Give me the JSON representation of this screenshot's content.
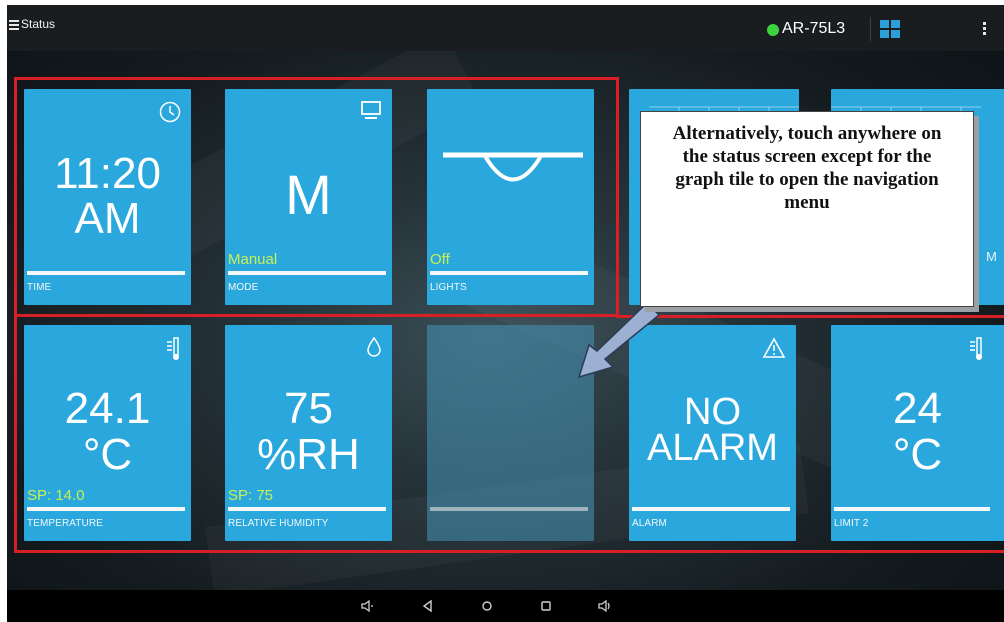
{
  "header": {
    "title": "Status",
    "device_id": "AR-75L3",
    "status_color": "#3dd23f"
  },
  "tiles": [
    {
      "value_line1": "11:20",
      "value_line2": "AM",
      "sub": "",
      "label": "TIME",
      "icon": "clock-icon"
    },
    {
      "value_line1": "M",
      "value_line2": "",
      "sub": "Manual",
      "label": "MODE",
      "icon": "monitor-icon"
    },
    {
      "value_line1": "",
      "value_line2": "",
      "sub": "Off",
      "label": "LIGHTS",
      "icon": "lamp-icon"
    },
    {
      "value_line1": "24.1",
      "value_line2": "°C",
      "sub": "SP: 14.0",
      "label": "TEMPERATURE",
      "icon": "thermometer-icon"
    },
    {
      "value_line1": "75",
      "value_line2": "%RH",
      "sub": "SP: 75",
      "label": "RELATIVE HUMIDITY",
      "icon": "droplet-icon"
    },
    {
      "value_line1": "",
      "value_line2": "",
      "sub": "",
      "label": "",
      "icon": ""
    },
    {
      "value_line1": "NO",
      "value_line2": "ALARM",
      "sub": "",
      "label": "ALARM",
      "icon": "warning-icon"
    },
    {
      "value_line1": "24",
      "value_line2": "°C",
      "sub": "",
      "label": "LIMIT 2",
      "icon": "thermometer-icon"
    }
  ],
  "graph_tile": {
    "label_fragment": "M"
  },
  "callout": {
    "text": "Alternatively, touch anywhere on the status screen except for the graph tile to open the navigation menu"
  },
  "navbar": {
    "buttons": [
      "volume-down-icon",
      "back-icon",
      "home-icon",
      "recents-icon",
      "volume-up-icon"
    ]
  },
  "colors": {
    "tile": "#2aa7dc",
    "highlight": "#d71f25",
    "sub_text": "#c8f052"
  }
}
